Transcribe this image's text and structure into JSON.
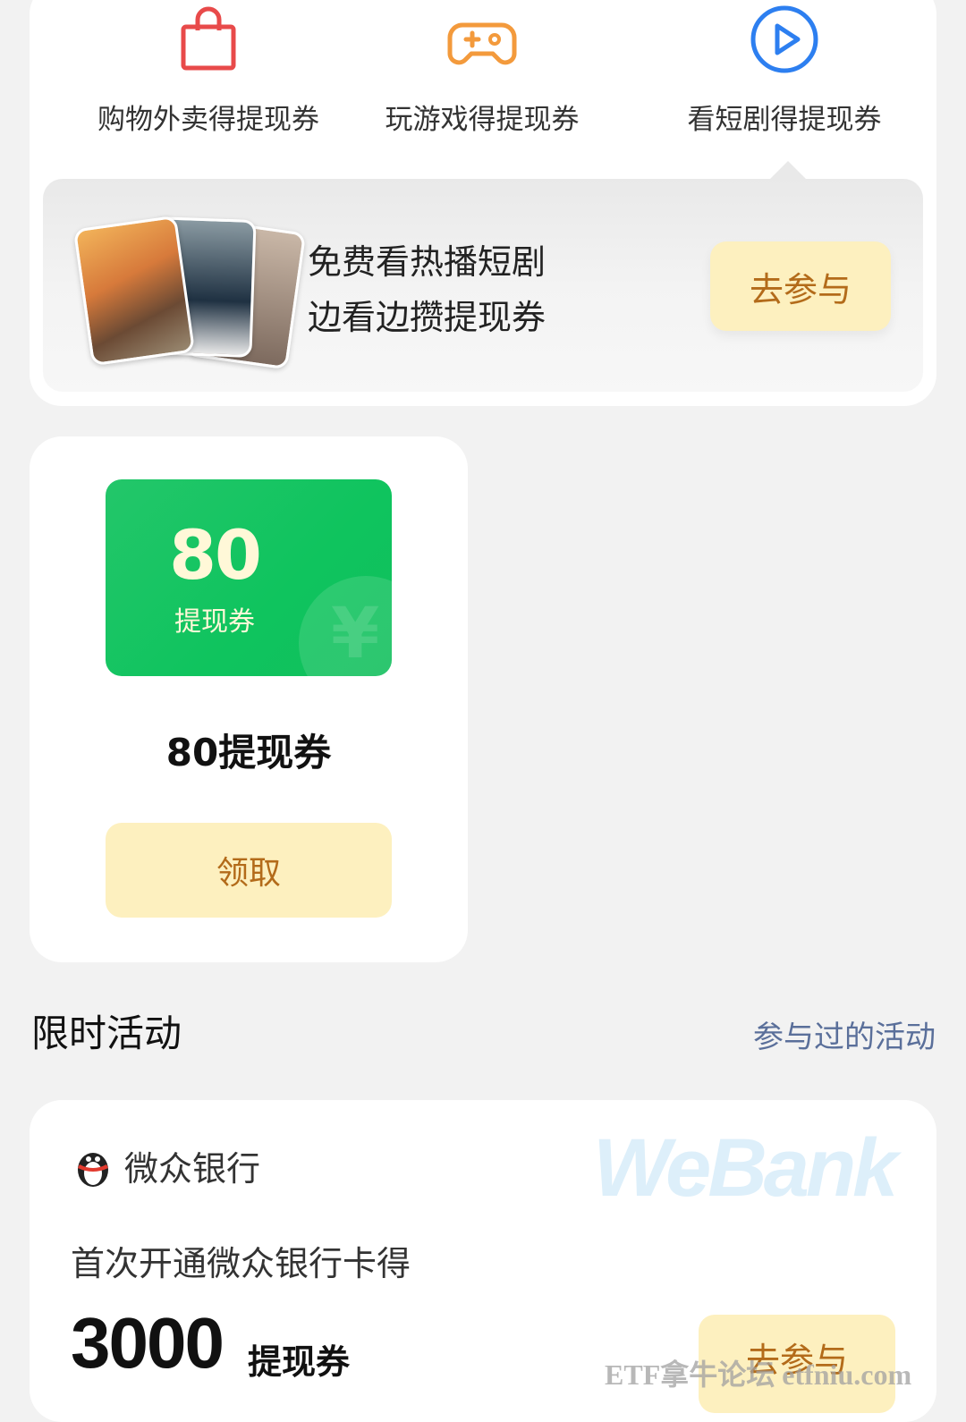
{
  "categories": [
    {
      "label": "购物外卖得提现券",
      "icon": "shopping-bag-icon",
      "color": "#e84a4a"
    },
    {
      "label": "玩游戏得提现券",
      "icon": "gamepad-icon",
      "color": "#f39a3c"
    },
    {
      "label": "看短剧得提现券",
      "icon": "play-icon",
      "color": "#2d7ff0"
    }
  ],
  "banner": {
    "line1": "免费看热播短剧",
    "line2": "边看边攒提现券",
    "button": "去参与"
  },
  "voucher": {
    "amount": "80",
    "unit": "提现券",
    "title": "80提现券",
    "button": "领取",
    "icon": "yen-icon",
    "color": "#14c563"
  },
  "section": {
    "title": "限时活动",
    "link": "参与过的活动"
  },
  "activity": {
    "bank_name": "微众银行",
    "brand_mark": "WeBank",
    "description": "首次开通微众银行卡得",
    "amount": "3000",
    "unit": "提现券",
    "button": "去参与"
  },
  "watermark": "ETF拿牛论坛 etfniu.com",
  "colors": {
    "accent_button_bg": "#fdf0bf",
    "accent_button_text": "#b36b1a",
    "link": "#5a6f9a"
  }
}
